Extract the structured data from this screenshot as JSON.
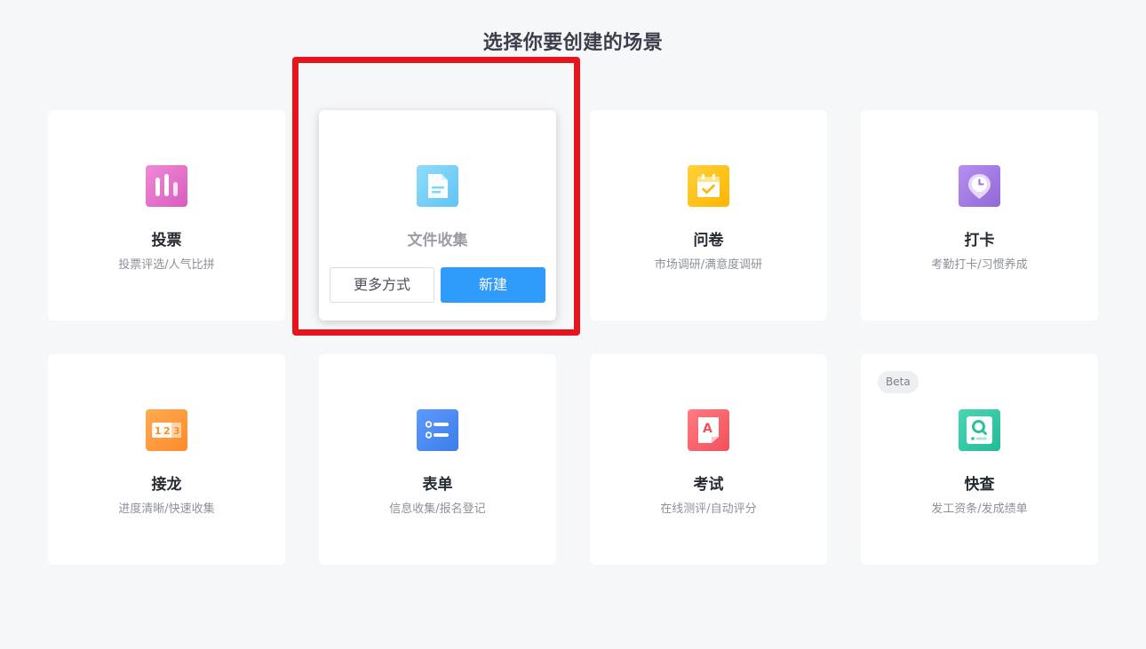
{
  "page_title": "选择你要创建的场景",
  "cards": [
    {
      "id": "vote",
      "name": "投票",
      "desc": "投票评选/人气比拼",
      "icon": "bar-chart-icon",
      "color": "#e067c6"
    },
    {
      "id": "file",
      "name": "文件收集",
      "desc": "",
      "icon": "document-icon",
      "color": "#6fcdf6",
      "more_label": "更多方式",
      "new_label": "新建"
    },
    {
      "id": "survey",
      "name": "问卷",
      "desc": "市场调研/满意度调研",
      "icon": "calendar-check-icon",
      "color": "#ffc21a"
    },
    {
      "id": "checkin",
      "name": "打卡",
      "desc": "考勤打卡/习惯养成",
      "icon": "clock-pin-icon",
      "color": "#a57be0"
    },
    {
      "id": "relay",
      "name": "接龙",
      "desc": "进度清晰/快速收集",
      "icon": "numbers-123-icon",
      "color": "#ff9a3c",
      "icon_text": [
        "1",
        "2",
        "3"
      ]
    },
    {
      "id": "form",
      "name": "表单",
      "desc": "信息收集/报名登记",
      "icon": "list-form-icon",
      "color": "#4b8df5"
    },
    {
      "id": "exam",
      "name": "考试",
      "desc": "在线测评/自动评分",
      "icon": "exam-paper-icon",
      "color": "#f6606a",
      "icon_text": "A"
    },
    {
      "id": "lookup",
      "name": "快查",
      "desc": "发工资条/发成绩单",
      "icon": "search-lookup-icon",
      "color": "#33c9a6",
      "badge": "Beta"
    }
  ]
}
